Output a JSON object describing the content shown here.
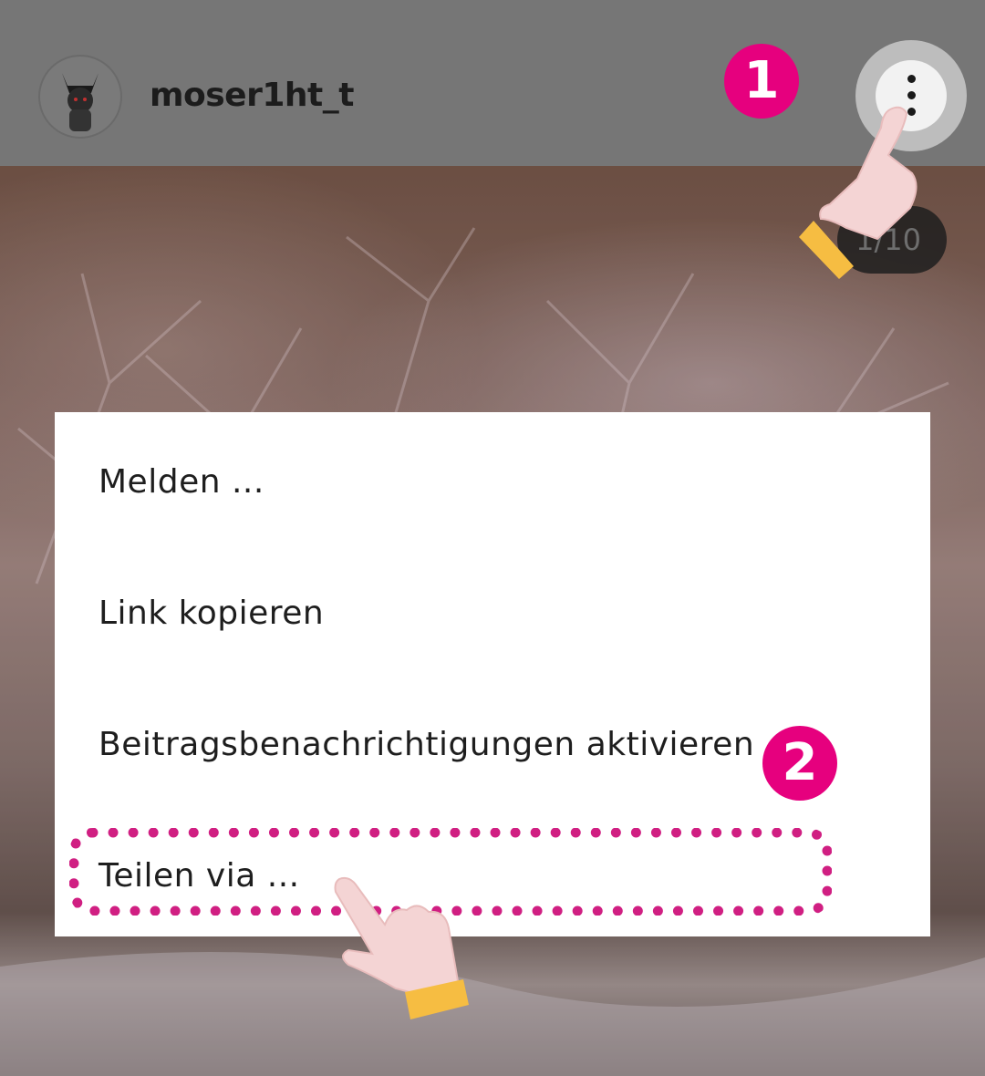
{
  "header": {
    "username": "moser1ht_t",
    "avatar_icon": "avatar-icon",
    "more_icon": "more-vertical-icon"
  },
  "image_counter": "1/10",
  "menu": {
    "items": [
      {
        "label": "Melden ..."
      },
      {
        "label": "Link kopieren"
      },
      {
        "label": "Beitragsbenachrichtigungen aktivieren"
      },
      {
        "label": "Teilen via ..."
      }
    ]
  },
  "annotations": {
    "step1": "1",
    "step2": "2",
    "badge_color": "#e6007e",
    "highlight_color": "#d01f82"
  }
}
